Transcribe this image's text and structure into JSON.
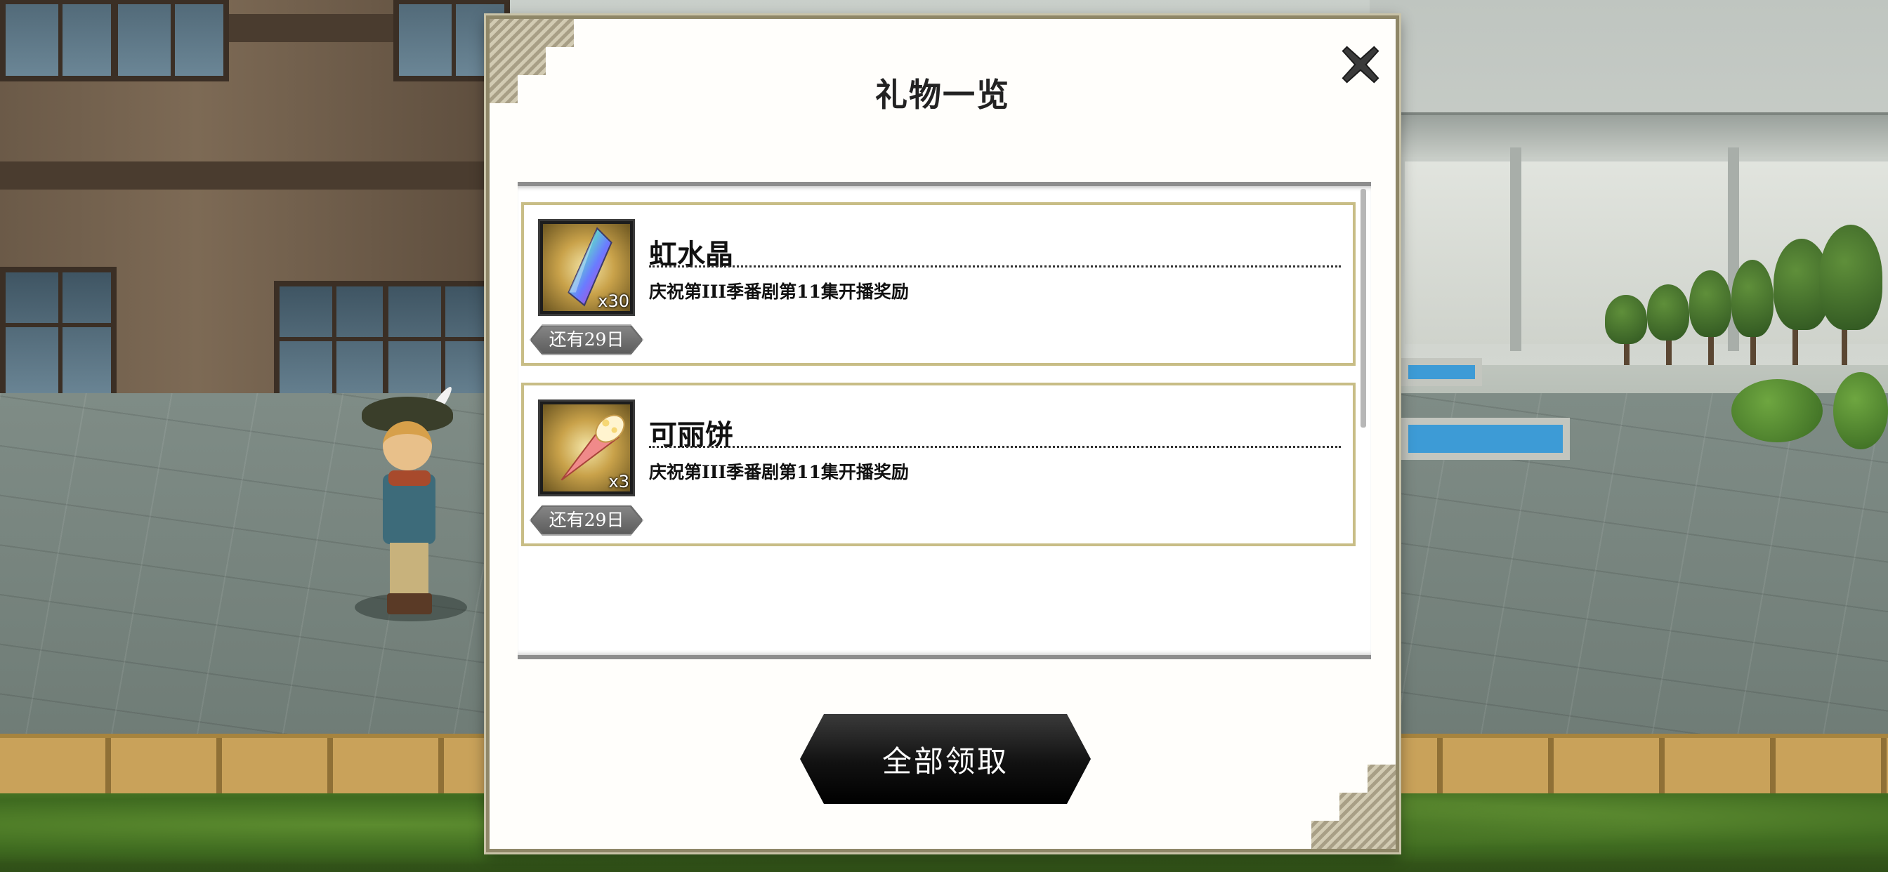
{
  "dialog": {
    "title": "礼物一览",
    "claim_all_label": "全部领取"
  },
  "gifts": [
    {
      "name": "虹水晶",
      "quantity": "x30",
      "description": "庆祝第III季番剧第11集开播奖励",
      "remaining": "还有29日",
      "icon": "rainbow-crystal-icon"
    },
    {
      "name": "可丽饼",
      "quantity": "x3",
      "description": "庆祝第III季番剧第11集开播奖励",
      "remaining": "还有29日",
      "icon": "crepe-icon"
    }
  ],
  "colors": {
    "dialog_border": "#8f8768",
    "item_border": "#c8bd86",
    "button_dark": "#111111"
  }
}
